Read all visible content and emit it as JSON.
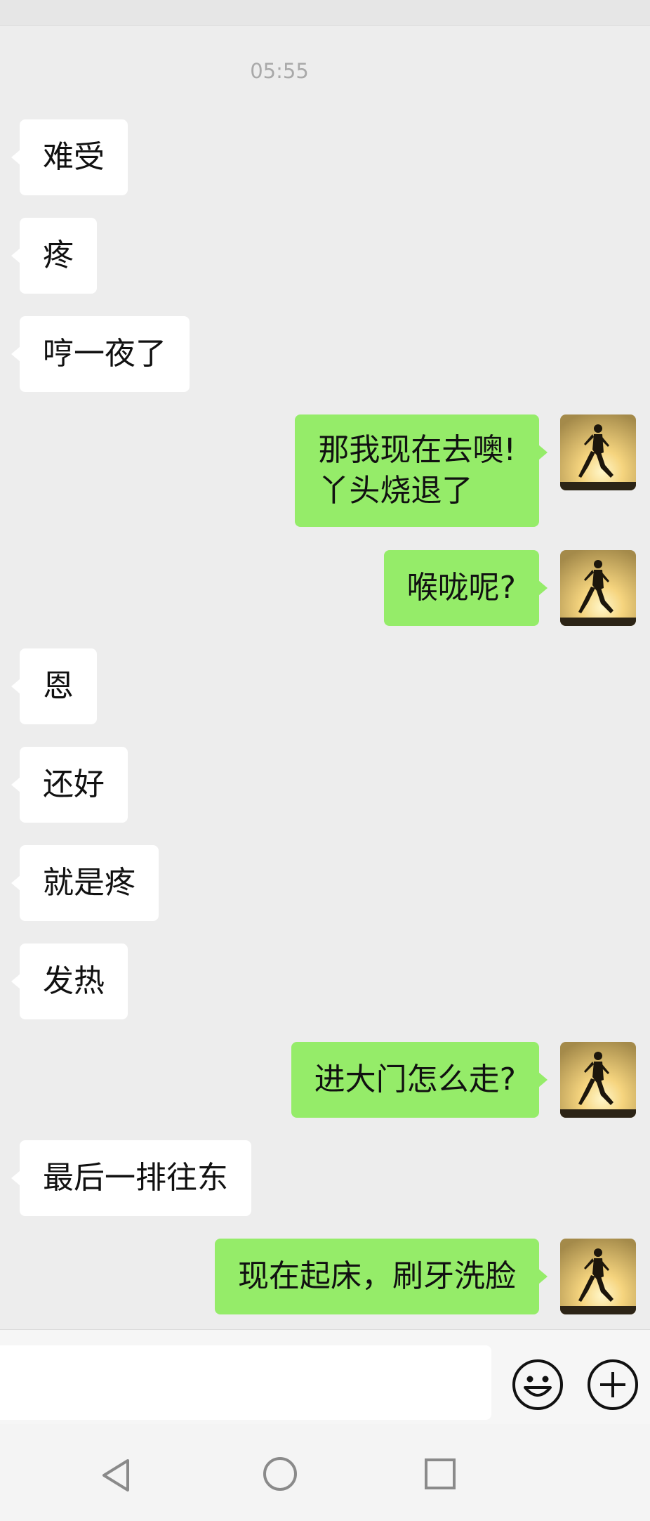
{
  "timestamp": "05:55",
  "messages": [
    {
      "side": "in",
      "text": "难受"
    },
    {
      "side": "in",
      "text": "疼"
    },
    {
      "side": "in",
      "text": "哼一夜了"
    },
    {
      "side": "out",
      "text": "那我现在去噢!\n丫头烧退了"
    },
    {
      "side": "out",
      "text": "喉咙呢?"
    },
    {
      "side": "in",
      "text": "恩"
    },
    {
      "side": "in",
      "text": "还好"
    },
    {
      "side": "in",
      "text": "就是疼"
    },
    {
      "side": "in",
      "text": "发热"
    },
    {
      "side": "out",
      "text": "进大门怎么走?"
    },
    {
      "side": "in",
      "text": "最后一排往东"
    },
    {
      "side": "out",
      "text": "现在起床，刷牙洗脸"
    }
  ],
  "input_bar": {
    "message_value": "",
    "emoji_icon": "emoji-icon",
    "plus_icon": "plus-icon"
  },
  "nav": {
    "back_icon": "triangle-back-icon",
    "home_icon": "circle-home-icon",
    "recent_icon": "square-recent-icon"
  },
  "colors": {
    "background": "#ededed",
    "incoming_bubble": "#ffffff",
    "outgoing_bubble": "#95ec69",
    "timestamp": "#a9a9a9"
  }
}
